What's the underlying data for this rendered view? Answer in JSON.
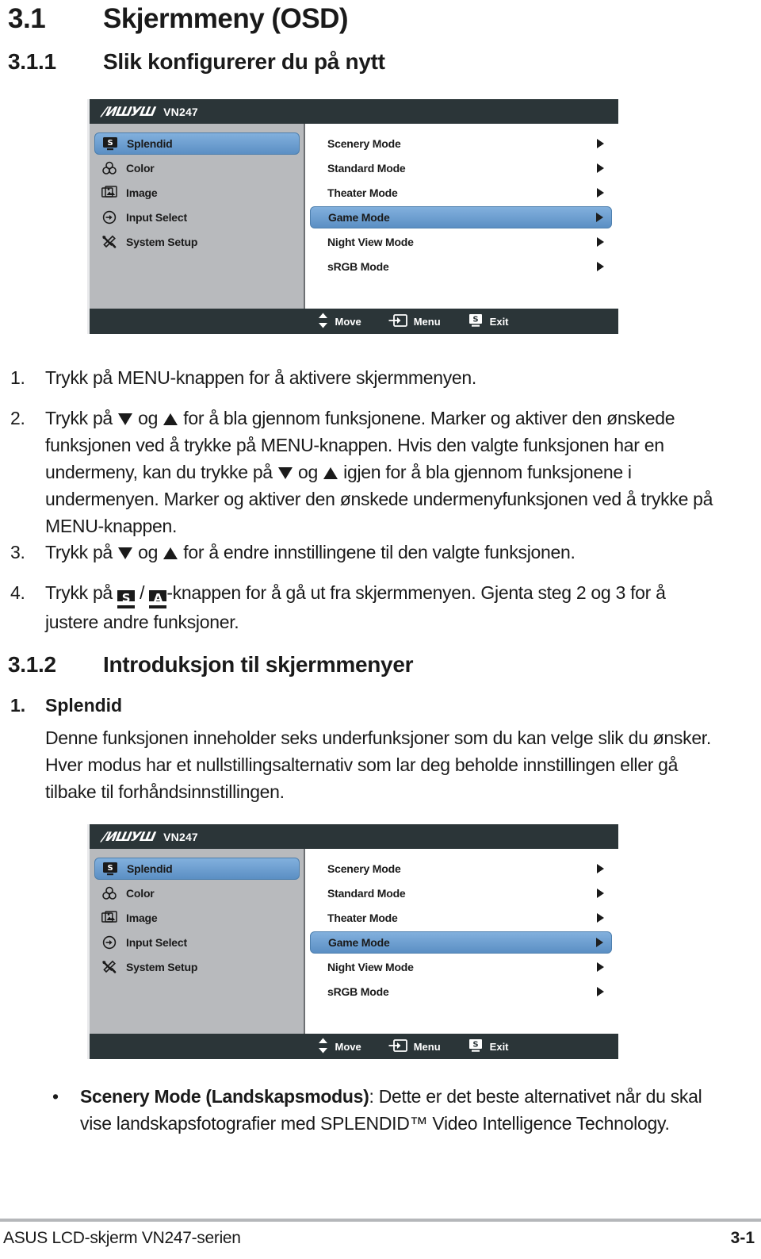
{
  "headings": {
    "h1_num": "3.1",
    "h1_text": "Skjermmeny (OSD)",
    "h2_num": "3.1.1",
    "h2_text": "Slik konfigurerer du på nytt",
    "h3_num": "3.1.2",
    "h3_text": "Introduksjon til skjermmenyer"
  },
  "osd": {
    "logo": "/ISUS",
    "model": "VN247",
    "sidebar": [
      {
        "label": "Splendid",
        "icon": "splendid-monitor-icon",
        "selected": true
      },
      {
        "label": "Color",
        "icon": "color-palette-icon",
        "selected": false
      },
      {
        "label": "Image",
        "icon": "image-picture-icon",
        "selected": false
      },
      {
        "label": "Input Select",
        "icon": "input-arrow-icon",
        "selected": false
      },
      {
        "label": "System Setup",
        "icon": "tools-wrench-icon",
        "selected": false
      }
    ],
    "items": [
      {
        "label": "Scenery Mode",
        "selected": false
      },
      {
        "label": "Standard Mode",
        "selected": false
      },
      {
        "label": "Theater Mode",
        "selected": false
      },
      {
        "label": "Game Mode",
        "selected": true
      },
      {
        "label": "Night View Mode",
        "selected": false
      },
      {
        "label": "sRGB Mode",
        "selected": false
      }
    ],
    "footer": [
      {
        "label": "Move",
        "icon": "updown-arrows-icon"
      },
      {
        "label": "Menu",
        "icon": "menu-enter-icon"
      },
      {
        "label": "Exit",
        "icon": "splendid-s-icon"
      }
    ],
    "colors": {
      "chrome": "#2b3538",
      "sidebar": "#b8babd",
      "highlight": "#6b9ad0",
      "panel": "#ffffff"
    }
  },
  "steps": [
    {
      "num": "1.",
      "parts": [
        {
          "t": "text",
          "v": "Trykk på MENU-knappen for å aktivere skjermmenyen."
        }
      ]
    },
    {
      "num": "2.",
      "parts": [
        {
          "t": "text",
          "v": "Trykk på "
        },
        {
          "t": "tri-down",
          "v": "▼"
        },
        {
          "t": "text",
          "v": " og "
        },
        {
          "t": "tri-up",
          "v": "▲"
        },
        {
          "t": "text",
          "v": " for å bla gjennom funksjonene. Marker og aktiver den ønskede funksjonen ved å trykke på MENU-knappen. Hvis den valgte funksjonen har en undermeny, kan du trykke på "
        },
        {
          "t": "tri-down",
          "v": "▼"
        },
        {
          "t": "text",
          "v": " og "
        },
        {
          "t": "tri-up",
          "v": "▲"
        },
        {
          "t": "text",
          "v": " igjen for å bla gjennom funksjonene i undermenyen. Marker og aktiver den ønskede undermenyfunksjonen ved å trykke på MENU-knappen."
        }
      ]
    },
    {
      "num": "3.",
      "parts": [
        {
          "t": "text",
          "v": "Trykk på "
        },
        {
          "t": "tri-down",
          "v": "▼"
        },
        {
          "t": "text",
          "v": " og "
        },
        {
          "t": "tri-up",
          "v": "▲"
        },
        {
          "t": "text",
          "v": " for å endre innstillingene til den valgte funksjonen."
        }
      ]
    },
    {
      "num": "4.",
      "parts": [
        {
          "t": "text",
          "v": "Trykk på "
        },
        {
          "t": "keycap",
          "v": "S"
        },
        {
          "t": "text",
          "v": " / "
        },
        {
          "t": "keycap",
          "v": "A"
        },
        {
          "t": "text",
          "v": "-knappen for å gå ut fra skjermmenyen. Gjenta steg 2 og 3 for å justere andre funksjoner."
        }
      ]
    }
  ],
  "splendid_section": {
    "num": "1.",
    "title": "Splendid",
    "body": "Denne funksjonen inneholder seks underfunksjoner som du kan velge slik du ønsker. Hver modus har et nullstillingsalternativ som lar deg beholde innstillingen eller gå tilbake til forhåndsinnstillingen."
  },
  "bullets": [
    {
      "bullet": "•",
      "bold": "Scenery Mode (Landskapsmodus)",
      "rest": ": Dette er det beste alternativet når du skal vise landskapsfotografier med SPLENDID™ Video Intelligence Technology."
    }
  ],
  "footer": {
    "left": "ASUS LCD-skjerm VN247-serien",
    "right": "3-1"
  }
}
